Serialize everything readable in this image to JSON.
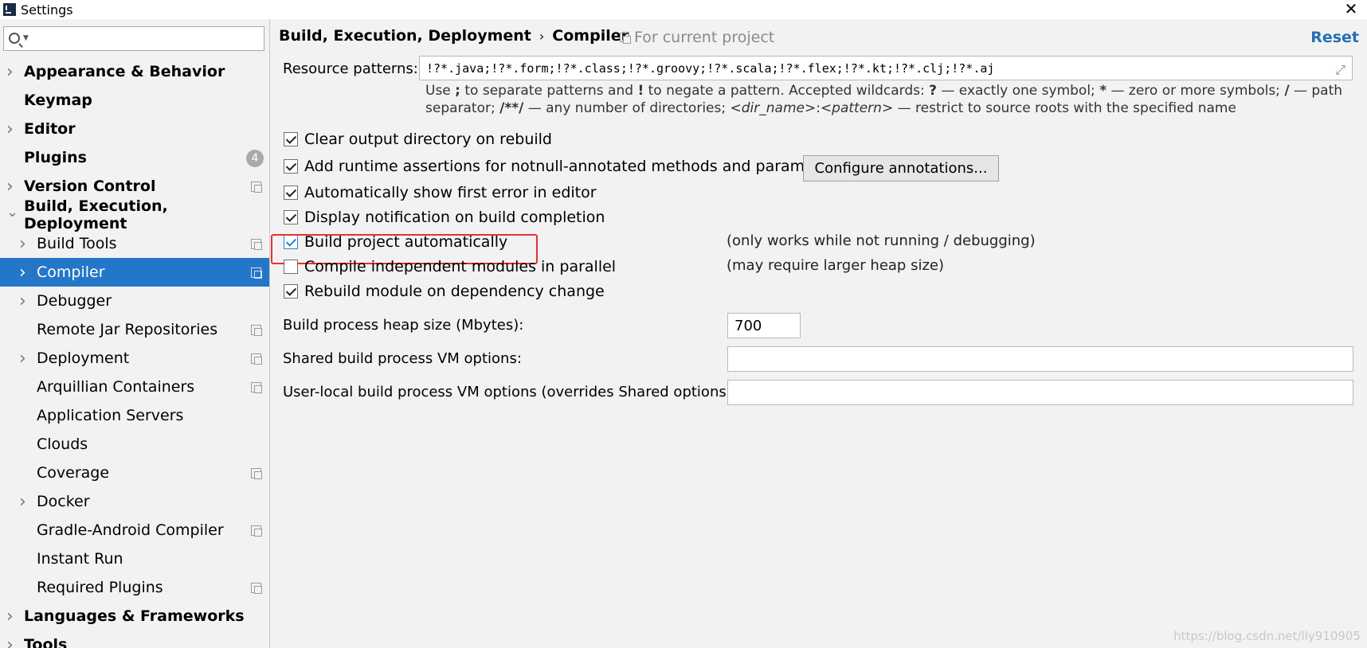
{
  "window": {
    "title": "Settings"
  },
  "search": {
    "placeholder": ""
  },
  "sidebar": {
    "items": [
      {
        "label": "Appearance & Behavior",
        "level": 0,
        "arrow": "right",
        "bold": true
      },
      {
        "label": "Keymap",
        "level": 0,
        "arrow": "",
        "bold": true
      },
      {
        "label": "Editor",
        "level": 0,
        "arrow": "right",
        "bold": true
      },
      {
        "label": "Plugins",
        "level": 0,
        "arrow": "",
        "bold": true,
        "badge": "4"
      },
      {
        "label": "Version Control",
        "level": 0,
        "arrow": "right",
        "bold": true,
        "project_icon": true
      },
      {
        "label": "Build, Execution, Deployment",
        "level": 0,
        "arrow": "down",
        "bold": true
      },
      {
        "label": "Build Tools",
        "level": 1,
        "arrow": "right",
        "project_icon": true
      },
      {
        "label": "Compiler",
        "level": 1,
        "arrow": "right",
        "project_icon": true,
        "selected": true
      },
      {
        "label": "Debugger",
        "level": 1,
        "arrow": "right"
      },
      {
        "label": "Remote Jar Repositories",
        "level": 1,
        "arrow": "",
        "project_icon": true
      },
      {
        "label": "Deployment",
        "level": 1,
        "arrow": "right",
        "project_icon": true
      },
      {
        "label": "Arquillian Containers",
        "level": 1,
        "arrow": "",
        "project_icon": true
      },
      {
        "label": "Application Servers",
        "level": 1,
        "arrow": ""
      },
      {
        "label": "Clouds",
        "level": 1,
        "arrow": ""
      },
      {
        "label": "Coverage",
        "level": 1,
        "arrow": "",
        "project_icon": true
      },
      {
        "label": "Docker",
        "level": 1,
        "arrow": "right"
      },
      {
        "label": "Gradle-Android Compiler",
        "level": 1,
        "arrow": "",
        "project_icon": true
      },
      {
        "label": "Instant Run",
        "level": 1,
        "arrow": ""
      },
      {
        "label": "Required Plugins",
        "level": 1,
        "arrow": "",
        "project_icon": true
      },
      {
        "label": "Languages & Frameworks",
        "level": 0,
        "arrow": "right",
        "bold": true
      },
      {
        "label": "Tools",
        "level": 0,
        "arrow": "right",
        "bold": true
      }
    ]
  },
  "header": {
    "crumb1": "Build, Execution, Deployment",
    "crumb_sep": "›",
    "crumb2": "Compiler",
    "for_project": "For current project",
    "reset": "Reset"
  },
  "resource_patterns": {
    "label": "Resource patterns:",
    "value": "!?*.java;!?*.form;!?*.class;!?*.groovy;!?*.scala;!?*.flex;!?*.kt;!?*.clj;!?*.aj"
  },
  "hint": {
    "p1": "Use ",
    "b1": ";",
    "p2": " to separate patterns and ",
    "b2": "!",
    "p3": " to negate a pattern. Accepted wildcards: ",
    "b3": "?",
    "p4": " — exactly one symbol; ",
    "b4": "*",
    "p5": " — zero or more symbols; ",
    "b5": "/",
    "p6": " — path separator; ",
    "b6": "/**/",
    "p7": " — any number of directories; ",
    "i1": "<dir_name>",
    "p8": ":",
    "i2": "<pattern>",
    "p9": " — restrict to source roots with the specified name"
  },
  "options": {
    "clear_output": {
      "label": "Clear output directory on rebuild",
      "checked": true
    },
    "runtime_assertions": {
      "label": "Add runtime assertions for notnull-annotated methods and parameters",
      "checked": true
    },
    "configure_annotations": "Configure annotations...",
    "show_first_error": {
      "label": "Automatically show first error in editor",
      "checked": true
    },
    "display_notification": {
      "label": "Display notification on build completion",
      "checked": true
    },
    "build_automatically": {
      "label": "Build project automatically",
      "checked": true,
      "note": "(only works while not running / debugging)"
    },
    "compile_parallel": {
      "label": "Compile independent modules in parallel",
      "checked": false,
      "note": "(may require larger heap size)"
    },
    "rebuild_on_dependency": {
      "label": "Rebuild module on dependency change",
      "checked": true
    }
  },
  "heap": {
    "label": "Build process heap size (Mbytes):",
    "value": "700"
  },
  "shared_vm": {
    "label": "Shared build process VM options:",
    "value": ""
  },
  "user_vm": {
    "label": "User-local build process VM options (overrides Shared options):",
    "value": ""
  },
  "watermark": "https://blog.csdn.net/lly910905"
}
